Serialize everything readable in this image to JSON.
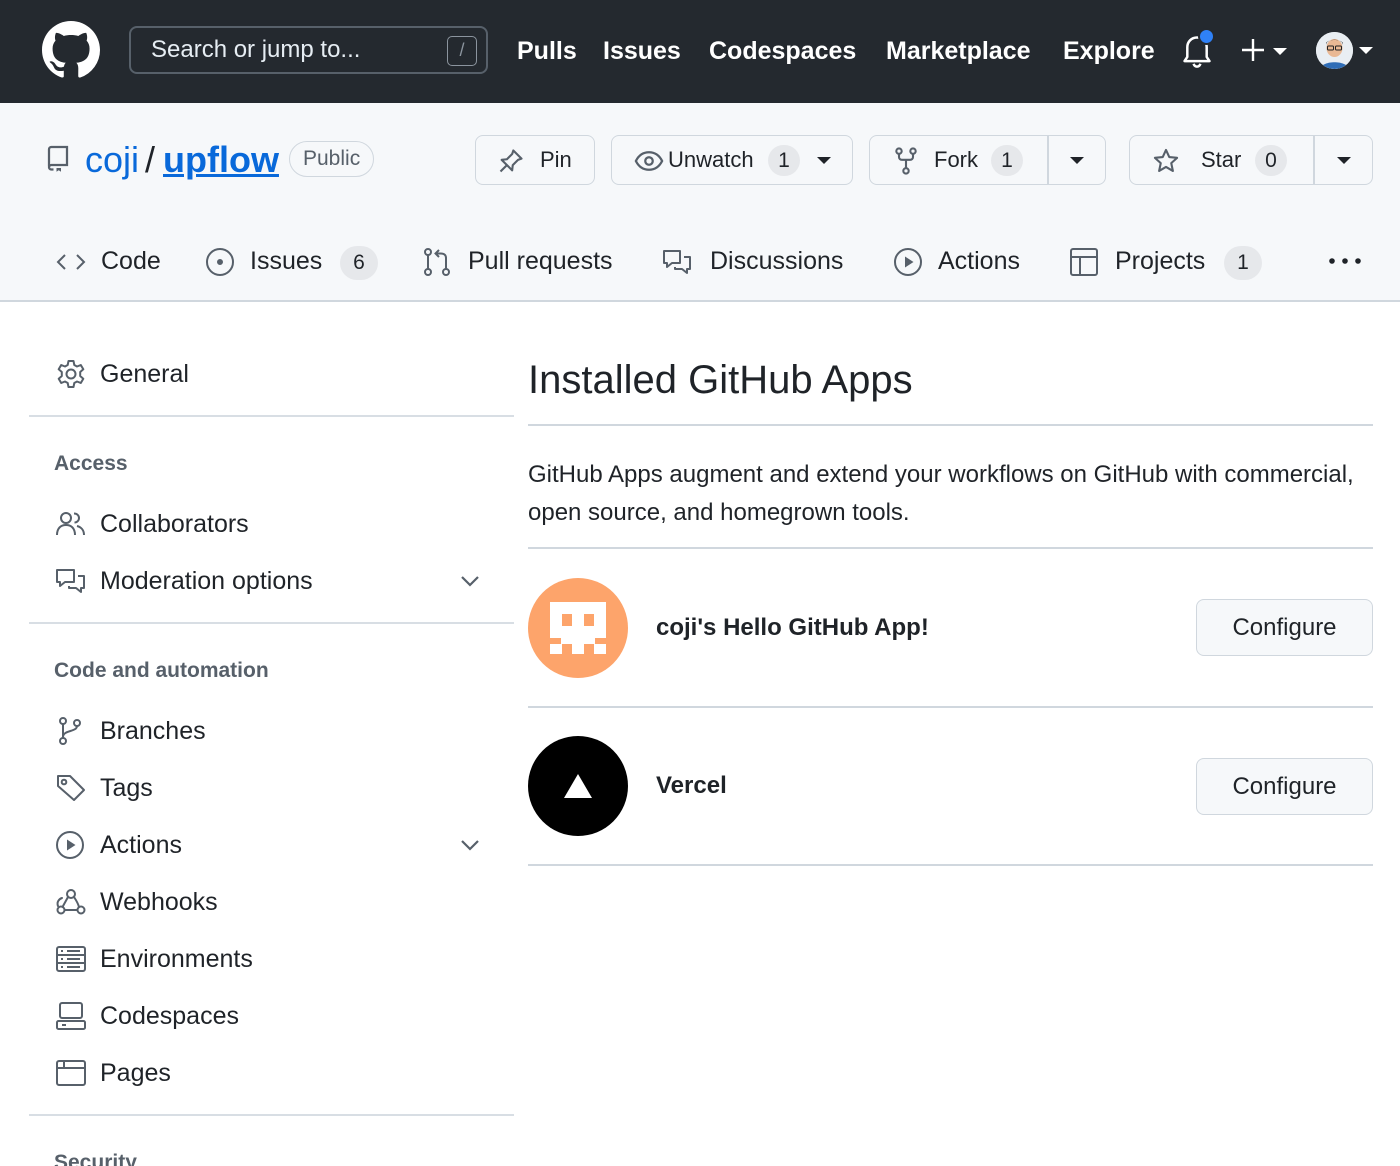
{
  "header": {
    "search_placeholder": "Search or jump to...",
    "search_shortcut": "/",
    "nav": [
      "Pulls",
      "Issues",
      "Codespaces",
      "Marketplace",
      "Explore"
    ]
  },
  "repo": {
    "owner": "coji",
    "separator": "/",
    "name": "upflow",
    "visibility": "Public",
    "pin_label": "Pin",
    "watch": {
      "label": "Unwatch",
      "count": "1"
    },
    "fork": {
      "label": "Fork",
      "count": "1"
    },
    "star": {
      "label": "Star",
      "count": "0"
    }
  },
  "tabs": {
    "code": "Code",
    "issues": {
      "label": "Issues",
      "count": "6"
    },
    "pulls": "Pull requests",
    "discussions": "Discussions",
    "actions": "Actions",
    "projects": {
      "label": "Projects",
      "count": "1"
    }
  },
  "sidebar": {
    "general": "General",
    "access_heading": "Access",
    "collaborators": "Collaborators",
    "moderation": "Moderation options",
    "code_heading": "Code and automation",
    "branches": "Branches",
    "tags": "Tags",
    "actions": "Actions",
    "webhooks": "Webhooks",
    "environments": "Environments",
    "codespaces": "Codespaces",
    "pages": "Pages",
    "security_heading": "Security"
  },
  "main": {
    "title": "Installed GitHub Apps",
    "description": "GitHub Apps augment and extend your workflows on GitHub with commercial, open source, and homegrown tools.",
    "apps": [
      {
        "name": "coji's Hello GitHub App!",
        "button": "Configure",
        "avatar_color": "#fda46b"
      },
      {
        "name": "Vercel",
        "button": "Configure",
        "avatar_color": "#000000"
      }
    ]
  },
  "colors": {
    "header_bg": "#24292f",
    "link": "#0969da",
    "notification_dot": "#2f81f7"
  }
}
